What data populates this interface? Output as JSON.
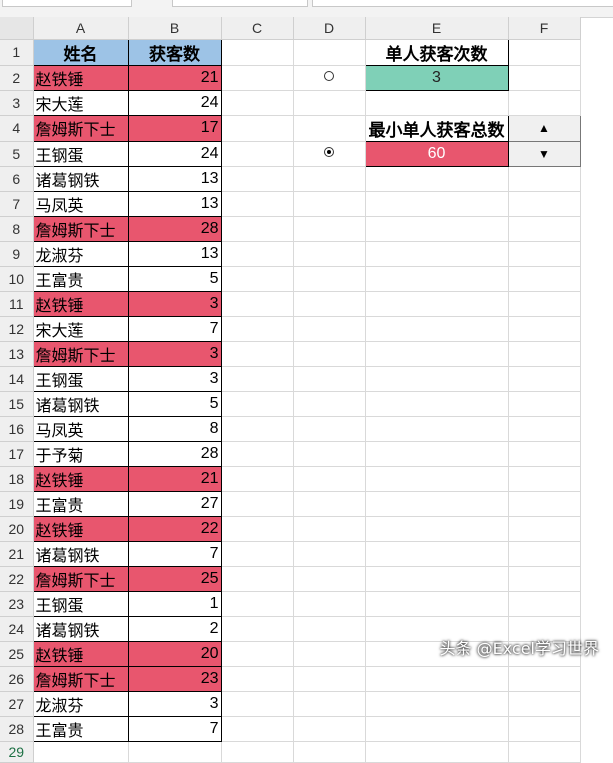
{
  "columns": [
    "A",
    "B",
    "C",
    "D",
    "E",
    "F"
  ],
  "header": {
    "name": "姓名",
    "count": "获客数"
  },
  "rows": [
    {
      "num": "2",
      "name": "赵铁锤",
      "value": "21",
      "hl": true
    },
    {
      "num": "3",
      "name": "宋大莲",
      "value": "24",
      "hl": false
    },
    {
      "num": "4",
      "name": "詹姆斯下士",
      "value": "17",
      "hl": true
    },
    {
      "num": "5",
      "name": "王钢蛋",
      "value": "24",
      "hl": false
    },
    {
      "num": "6",
      "name": "诸葛钢铁",
      "value": "13",
      "hl": false
    },
    {
      "num": "7",
      "name": "马凤英",
      "value": "13",
      "hl": false
    },
    {
      "num": "8",
      "name": "詹姆斯下士",
      "value": "28",
      "hl": true
    },
    {
      "num": "9",
      "name": "龙淑芬",
      "value": "13",
      "hl": false
    },
    {
      "num": "10",
      "name": "王富贵",
      "value": "5",
      "hl": false
    },
    {
      "num": "11",
      "name": "赵铁锤",
      "value": "3",
      "hl": true
    },
    {
      "num": "12",
      "name": "宋大莲",
      "value": "7",
      "hl": false
    },
    {
      "num": "13",
      "name": "詹姆斯下士",
      "value": "3",
      "hl": true
    },
    {
      "num": "14",
      "name": "王钢蛋",
      "value": "3",
      "hl": false
    },
    {
      "num": "15",
      "name": "诸葛钢铁",
      "value": "5",
      "hl": false
    },
    {
      "num": "16",
      "name": "马凤英",
      "value": "8",
      "hl": false
    },
    {
      "num": "17",
      "name": "于予菊",
      "value": "28",
      "hl": false
    },
    {
      "num": "18",
      "name": "赵铁锤",
      "value": "21",
      "hl": true
    },
    {
      "num": "19",
      "name": "王富贵",
      "value": "27",
      "hl": false
    },
    {
      "num": "20",
      "name": "赵铁锤",
      "value": "22",
      "hl": true
    },
    {
      "num": "21",
      "name": "诸葛钢铁",
      "value": "7",
      "hl": false
    },
    {
      "num": "22",
      "name": "詹姆斯下士",
      "value": "25",
      "hl": true
    },
    {
      "num": "23",
      "name": "王钢蛋",
      "value": "1",
      "hl": false
    },
    {
      "num": "24",
      "name": "诸葛钢铁",
      "value": "2",
      "hl": false
    },
    {
      "num": "25",
      "name": "赵铁锤",
      "value": "20",
      "hl": true
    },
    {
      "num": "26",
      "name": "詹姆斯下士",
      "value": "23",
      "hl": true
    },
    {
      "num": "27",
      "name": "龙淑芬",
      "value": "3",
      "hl": false
    },
    {
      "num": "28",
      "name": "王富贵",
      "value": "7",
      "hl": false
    }
  ],
  "row_one": "1",
  "row_last": "29",
  "side_panel": {
    "min_times_label": "单人获客次数",
    "min_times_value": "3",
    "min_total_label": "最小单人获客总数",
    "min_total_value": "60",
    "spin_up": "▲",
    "spin_down": "▼",
    "radio_times_checked": false,
    "radio_total_checked": true
  },
  "watermark": "头条 @Excel学习世界",
  "colors": {
    "header_blue": "#9dc3e6",
    "highlight_red": "#e8566e",
    "teal": "#7fd0b7"
  }
}
